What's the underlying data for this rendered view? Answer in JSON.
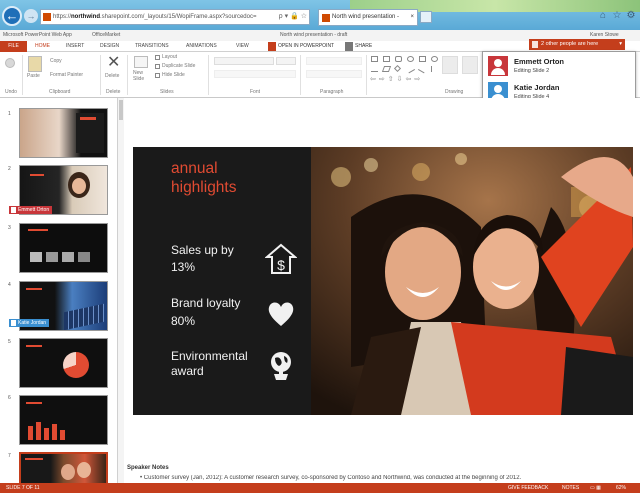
{
  "browser": {
    "url_prefix": "https://",
    "url_host": "northwind",
    "url_rest": ".sharepoint.com/_layouts/15/WopiFrame.aspx?sourcedoc=",
    "address_controls": "ρ ▾ 🔒 ☆",
    "tab_title": "North wind presentation -",
    "tab_close": "×",
    "home_glyph": "⌂",
    "star_glyph": "☆",
    "gear_glyph": "⚙",
    "back_glyph": "←",
    "fwd_glyph": "→"
  },
  "app": {
    "name": "Microsoft PowerPoint Web App",
    "site": "OfficeMarket",
    "doc_title": "North wind presentation - draft",
    "user": "Karen Stowe"
  },
  "ribbon_tabs": [
    "FILE",
    "HOME",
    "INSERT",
    "DESIGN",
    "TRANSITIONS",
    "ANIMATIONS",
    "VIEW"
  ],
  "ribbon_actions": {
    "open_in_ppt": "OPEN IN POWERPOINT",
    "share": "SHARE"
  },
  "ribbon": {
    "paste": "Paste",
    "copy": "Copy",
    "format_painter": "Format Painter",
    "delete": "Delete",
    "new_slide": "New Slide",
    "layout": "Layout",
    "duplicate": "Duplicate Slide",
    "hide": "Hide Slide",
    "groups": {
      "undo": "Undo",
      "clipboard": "Clipboard",
      "delete": "Delete",
      "slides": "Slides",
      "font": "Font",
      "paragraph": "Paragraph",
      "drawing": "Drawing"
    }
  },
  "collab": {
    "button": "2 other people are here",
    "users": [
      {
        "name": "Emmett Orton",
        "status": "Editing Slide 2",
        "color": "#c8363a"
      },
      {
        "name": "Katie Jordan",
        "status": "Editing Slide 4",
        "color": "#3a8fd0"
      }
    ]
  },
  "thumbs": {
    "numbers": [
      "1",
      "2",
      "3",
      "4",
      "5",
      "6",
      "7"
    ],
    "flag_emmett": "Emmett Orton",
    "flag_katie": "Katie Jordan"
  },
  "slide": {
    "title": "annual highlights",
    "items": [
      {
        "label": "Sales up by",
        "value": "13%"
      },
      {
        "label": "Brand loyalty",
        "value": "80%"
      },
      {
        "label": "Environmental",
        "value": "award"
      }
    ]
  },
  "notes": {
    "label": "Speaker Notes",
    "text": "• Customer survey (Jan, 2012): A customer research survey, co-sponsored by Contoso and Northwind, was conducted at the beginning of 2012."
  },
  "status": {
    "slide": "SLIDE 7 OF 11",
    "feedback": "GIVE FEEDBACK",
    "notes": "NOTES",
    "zoom": "62%"
  },
  "colors": {
    "accent": "#c43e1c",
    "slide_title": "#e14b32"
  }
}
